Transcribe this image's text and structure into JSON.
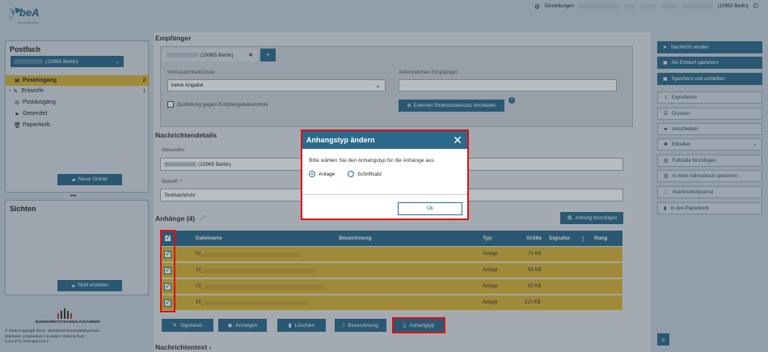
{
  "header": {
    "logo": "beA",
    "logo_sub": "Mein Anwalt Online",
    "settings": "Einstellungen",
    "user_suffix": "(10965 Berlin)"
  },
  "left": {
    "postfach_title": "Postfach",
    "postfach_select": "(10965 Berlin)",
    "nav": [
      {
        "label": "Posteingang",
        "count": "2"
      },
      {
        "label": "Entwürfe",
        "count": "1"
      },
      {
        "label": "Postausgang",
        "count": ""
      },
      {
        "label": "Gesendet",
        "count": ""
      },
      {
        "label": "Papierkorb",
        "count": ""
      }
    ],
    "new_folder": "Neuer Ordner",
    "views_title": "Sichten",
    "create_view": "Sicht erstellen",
    "chamber": "BUNDESRECHTSANWALTSKAMMER",
    "footer_line1": "© 2025 Copyright 2015 - Bundesrechtsanwaltskammer",
    "footer_line2": "Startseite | Impressum | Kontakt | Datenschutz",
    "footer_line3": "4.0.2.472, bea-app-c21-2"
  },
  "main": {
    "recipient_title": "Empfänger",
    "recipient_chip": "(10965 Berlin)",
    "add_symbol": "+",
    "confidentiality_label": "Vertraulichkeitsstufe:",
    "confidentiality_value": "keine Angabe",
    "file_ref_label": "Aktenzeichen Empfänger:",
    "delivery_check": "Zustellung gegen Empfangsbekenntnis",
    "upload_button": "Externen Strukturdatensatz hochladen",
    "details_title": "Nachrichtendetails",
    "sender_label": "Absender:",
    "sender_value": "(10965 Berlin)",
    "subject_label": "Betreff: *",
    "subject_value": "Testnachricht",
    "attachments_title": "Anhänge (4)",
    "add_attachment": "Anhang hinzufügen",
    "columns": [
      "Dateiname",
      "Bezeichnung",
      "Typ",
      "Größe",
      "Signatur",
      "⋮",
      "Rang"
    ],
    "rows": [
      {
        "name": "01_",
        "type": "Anlage",
        "size": "76 KB"
      },
      {
        "name": "02_",
        "type": "Anlage",
        "size": "69 KB"
      },
      {
        "name": "03_",
        "type": "Anlage",
        "size": "82 KB"
      },
      {
        "name": "05_",
        "type": "Anlage",
        "size": "210 KB"
      }
    ],
    "actions": {
      "sign": "Signieren",
      "view": "Anzeigen",
      "delete": "Löschen",
      "label": "Bezeichnung",
      "type": "Anhangtyp"
    },
    "message_text": "Nachrichtentext ›"
  },
  "right": {
    "buttons": [
      "Nachricht senden",
      "Als Entwurf speichern",
      "Speichern und schließen",
      "Exportieren",
      "Drucken",
      "Verschieben",
      "Etiketten",
      "Fußzeile hinzufügen",
      "In mein Adressbuch speichern",
      "Nachrichtenjournal",
      "In den Papierkorb"
    ],
    "expand": "»"
  },
  "modal": {
    "title": "Anhangstyp ändern",
    "text": "Bitte wählen Sie den Anhangstyp für die Anhänge aus.",
    "option1": "Anlage",
    "option2": "Schriftsatz",
    "ok": "Ok"
  }
}
